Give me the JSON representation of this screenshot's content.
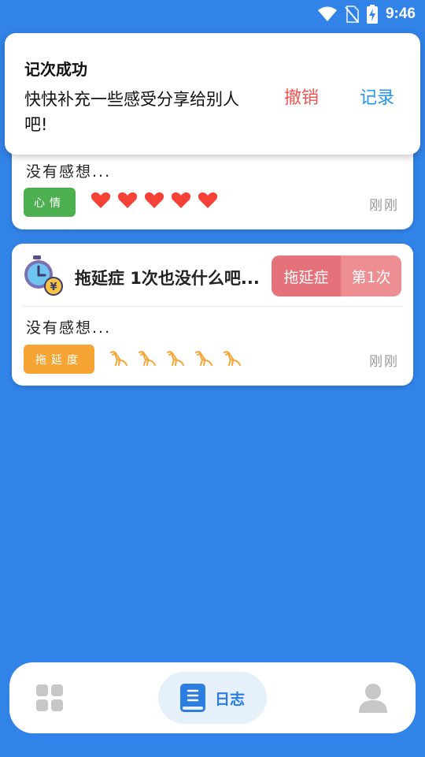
{
  "status_bar": {
    "time": "9:46"
  },
  "toast": {
    "title": "记次成功",
    "message": "快快补充一些感受分享给别人吧!",
    "undo_label": "撤销",
    "record_label": "记录"
  },
  "entries": [
    {
      "thought": "没有感想...",
      "tag": "心情",
      "rating": {
        "icon": "heart-icon",
        "count": 5,
        "color": "#f44336"
      },
      "time_ago": "刚刚"
    },
    {
      "title": "拖延症 1次也没什么吧...",
      "category": "拖延症",
      "count_label": "第1次",
      "thought": "没有感想...",
      "tag": "拖延度",
      "rating": {
        "icon": "bird-icon",
        "count": 5,
        "color": "#f6a534"
      },
      "time_ago": "刚刚"
    }
  ],
  "bottom_nav": {
    "active_label": "日志"
  },
  "colors": {
    "background": "#3283e8",
    "accent": "#2b7de0",
    "mood_tag": "#4caf50",
    "delay_tag": "#f6a534"
  }
}
